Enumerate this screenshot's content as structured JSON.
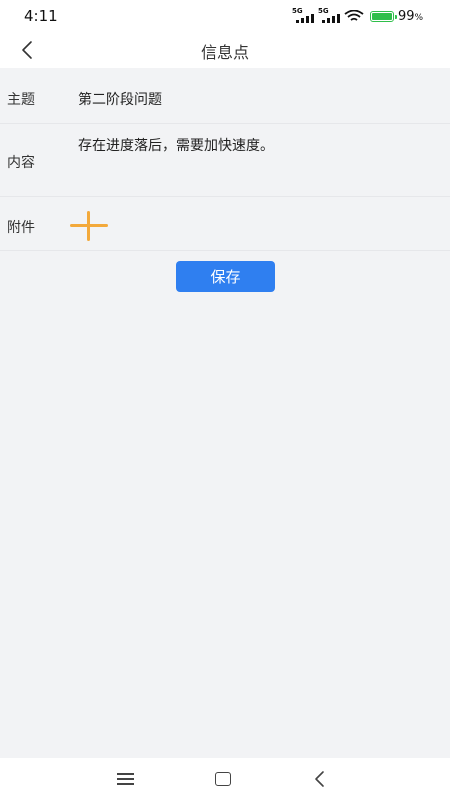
{
  "status_bar": {
    "time": "4:11",
    "sim1_label": "5G",
    "sim2_label": "5G",
    "battery_percent": "99",
    "battery_unit": "%",
    "battery_level": 0.99,
    "icons": [
      "signal-icon",
      "signal-icon",
      "wifi-icon",
      "battery-charging-icon"
    ]
  },
  "header": {
    "title": "信息点",
    "back_icon": "chevron-left-icon"
  },
  "form": {
    "subject_label": "主题",
    "subject_value": "第二阶段问题",
    "content_label": "内容",
    "content_value": "存在进度落后，需要加快速度。",
    "attachment_label": "附件",
    "add_icon": "plus-icon",
    "accent_color": "#f3a93b"
  },
  "actions": {
    "save_label": "保存",
    "save_color": "#2f7ff0"
  },
  "system_nav": {
    "icons": [
      "menu-icon",
      "home-icon",
      "back-icon"
    ]
  }
}
